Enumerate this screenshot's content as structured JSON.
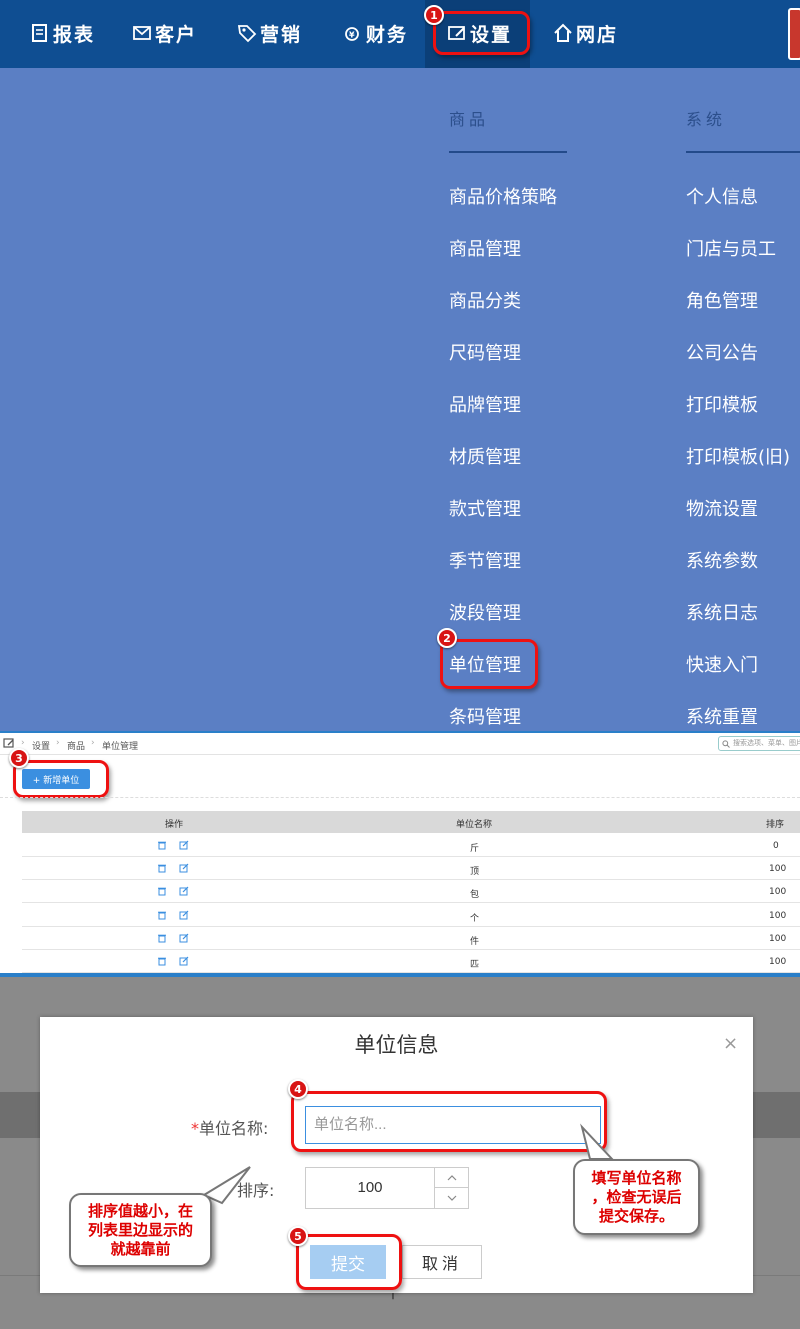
{
  "nav": {
    "items": [
      {
        "label": "报表",
        "icon": "report-icon"
      },
      {
        "label": "客户",
        "icon": "mail-icon"
      },
      {
        "label": "营销",
        "icon": "tag-icon"
      },
      {
        "label": "财务",
        "icon": "finance-icon"
      },
      {
        "label": "设置",
        "icon": "settings-icon",
        "active": true
      },
      {
        "label": "网店",
        "icon": "home-icon"
      }
    ]
  },
  "menu": {
    "goods": {
      "heading": "商品",
      "items": [
        "商品价格策略",
        "商品管理",
        "商品分类",
        "尺码管理",
        "品牌管理",
        "材质管理",
        "款式管理",
        "季节管理",
        "波段管理",
        "单位管理",
        "条码管理"
      ]
    },
    "system": {
      "heading": "系统",
      "items": [
        "个人信息",
        "门店与员工",
        "角色管理",
        "公司公告",
        "打印模板",
        "打印模板(旧)",
        "物流设置",
        "系统参数",
        "系统日志",
        "快速入门",
        "系统重置"
      ]
    }
  },
  "steps": [
    "1",
    "2",
    "3",
    "4",
    "5"
  ],
  "list": {
    "breadcrumb": [
      "设置",
      "商品",
      "单位管理"
    ],
    "search_placeholder": "搜索选项、菜单、图片",
    "add_button": "+ 新增单位",
    "headers": {
      "ops": "操作",
      "name": "单位名称",
      "sort": "排序"
    },
    "rows": [
      {
        "name": "斤",
        "sort": "0"
      },
      {
        "name": "顶",
        "sort": "100"
      },
      {
        "name": "包",
        "sort": "100"
      },
      {
        "name": "个",
        "sort": "100"
      },
      {
        "name": "件",
        "sort": "100"
      },
      {
        "name": "匹",
        "sort": "100"
      }
    ]
  },
  "dialog": {
    "title": "单位信息",
    "close": "×",
    "name_label": "单位名称:",
    "required_mark": "*",
    "name_placeholder": "单位名称...",
    "sort_label": "排序:",
    "sort_value": "100",
    "submit": "提交",
    "cancel": "取消",
    "bg_text": "个"
  },
  "tips": {
    "right": "填写单位名称\n，检查无误后\n提交保存。",
    "left": "排序值越小，在\n列表里边显示的\n就越靠前"
  },
  "colors": {
    "nav_bg": "#0f4e92",
    "menu_bg": "#5b7fc4",
    "callout": "#e11111",
    "primary": "#3b8fe0"
  }
}
